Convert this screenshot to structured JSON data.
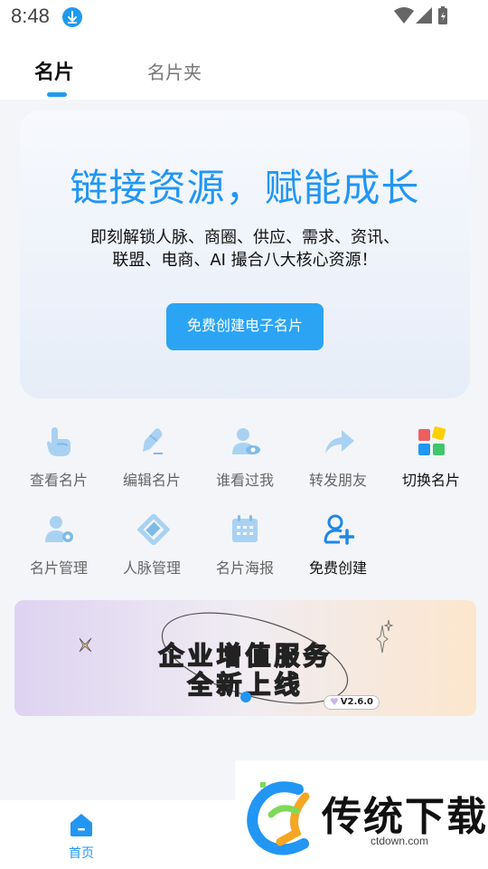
{
  "status": {
    "time": "8:48"
  },
  "tabs": [
    {
      "label": "名片"
    },
    {
      "label": "名片夹"
    }
  ],
  "hero": {
    "title": "链接资源，赋能成长",
    "subtitle_line1": "即刻解锁人脉、商圈、供应、需求、资讯、",
    "subtitle_line2": "联盟、电商、AI 撮合八大核心资源！",
    "button": "免费创建电子名片"
  },
  "grid": [
    {
      "label": "查看名片",
      "icon": "pointer-hand-icon"
    },
    {
      "label": "编辑名片",
      "icon": "edit-pen-icon"
    },
    {
      "label": "谁看过我",
      "icon": "user-eye-icon"
    },
    {
      "label": "转发朋友",
      "icon": "forward-arrow-icon"
    },
    {
      "label": "切换名片",
      "icon": "colored-grid-icon"
    },
    {
      "label": "名片管理",
      "icon": "user-gear-icon"
    },
    {
      "label": "人脉管理",
      "icon": "contact-tag-icon"
    },
    {
      "label": "名片海报",
      "icon": "calendar-poster-icon"
    },
    {
      "label": "免费创建",
      "icon": "add-user-icon"
    }
  ],
  "banner": {
    "line1": "企业增值服务",
    "line2": "全新上线",
    "version": "V2.6.0"
  },
  "nav": {
    "home": "首页"
  },
  "watermark": {
    "title": "传统下载",
    "url": "ctdown.com"
  },
  "colors": {
    "accent": "#2196f3",
    "icon_light": "#a9d2f2"
  }
}
